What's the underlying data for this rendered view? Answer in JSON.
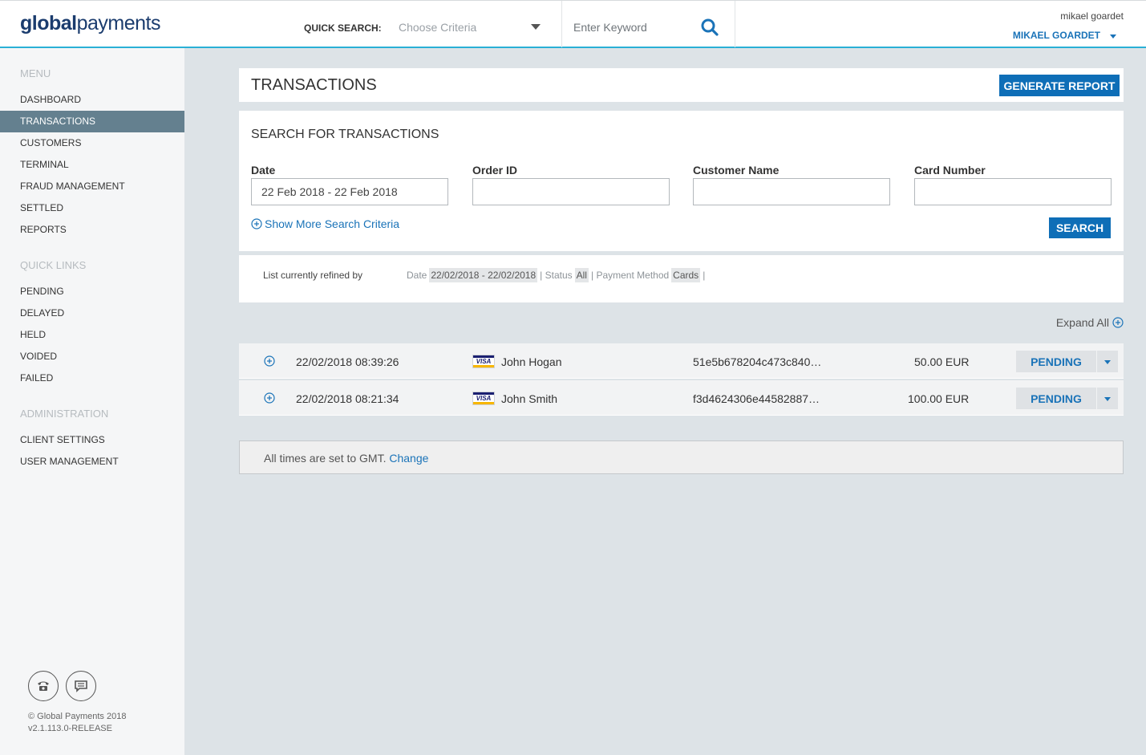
{
  "header": {
    "logo_bold": "global",
    "logo_light": "payments",
    "quick_search_label": "QUICK SEARCH:",
    "criteria_placeholder": "Choose Criteria",
    "keyword_placeholder": "Enter Keyword",
    "username_small": "mikael goardet",
    "username_big": "MIKAEL GOARDET"
  },
  "sidebar": {
    "menu_heading": "MENU",
    "menu_items": [
      "DASHBOARD",
      "TRANSACTIONS",
      "CUSTOMERS",
      "TERMINAL",
      "FRAUD MANAGEMENT",
      "SETTLED",
      "REPORTS"
    ],
    "active_item": "TRANSACTIONS",
    "quick_links_heading": "QUICK LINKS",
    "quick_links": [
      "PENDING",
      "DELAYED",
      "HELD",
      "VOIDED",
      "FAILED"
    ],
    "admin_heading": "ADMINISTRATION",
    "admin_items": [
      "CLIENT SETTINGS",
      "USER MANAGEMENT"
    ],
    "copyright": "© Global Payments 2018",
    "version": "v2.1.113.0-RELEASE"
  },
  "main": {
    "title": "TRANSACTIONS",
    "generate_report": "GENERATE REPORT",
    "search_title": "SEARCH FOR TRANSACTIONS",
    "fields": {
      "date_label": "Date",
      "date_value": "22 Feb 2018 - 22 Feb 2018",
      "order_label": "Order ID",
      "customer_label": "Customer Name",
      "card_label": "Card Number"
    },
    "show_more": "Show More Search Criteria",
    "search_button": "SEARCH",
    "refine": {
      "label": "List currently refined by",
      "date_key": "Date",
      "date_value": "22/02/2018 - 22/02/2018",
      "status_key": "Status",
      "status_value": "All",
      "payment_key": "Payment Method",
      "payment_value": "Cards"
    },
    "expand_all": "Expand All",
    "transactions": [
      {
        "datetime": "22/02/2018 08:39:26",
        "card_brand": "VISA",
        "customer": "John Hogan",
        "order_id": "51e5b678204c473c840…",
        "amount": "50.00 EUR",
        "status": "PENDING"
      },
      {
        "datetime": "22/02/2018 08:21:34",
        "card_brand": "VISA",
        "customer": "John Smith",
        "order_id": "f3d4624306e44582887…",
        "amount": "100.00 EUR",
        "status": "PENDING"
      }
    ],
    "timezone_text": "All times are set to GMT.",
    "timezone_link": "Change"
  },
  "colors": {
    "accent_blue": "#0e6eb7",
    "link_blue": "#1a73b8",
    "header_line": "#2ab0d6",
    "sidebar_active": "#64808f",
    "page_bg": "#dde3e7"
  }
}
